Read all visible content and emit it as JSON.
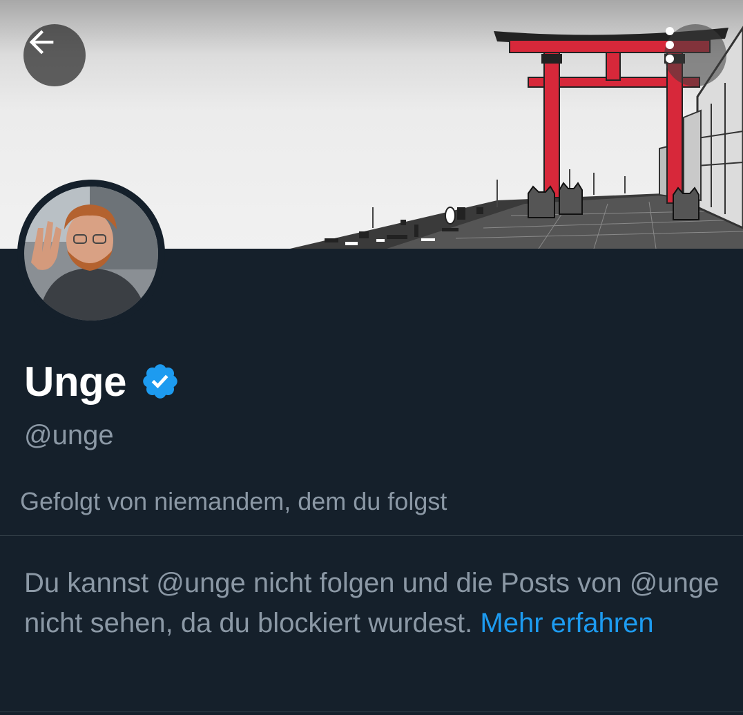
{
  "header": {
    "back_icon": "arrow-left-icon",
    "more_icon": "more-vertical-icon"
  },
  "banner": {
    "description_icon": "torii-gate-street-illustration",
    "accent_color": "#d7283a"
  },
  "profile": {
    "display_name": "Unge",
    "verified_icon": "verified-badge-icon",
    "verified_color": "#1d9bf0",
    "handle": "@unge",
    "followed_by": "Gefolgt von niemandem, dem du folgst"
  },
  "blocked_notice": {
    "text": "Du kannst @unge nicht folgen und die Posts von @unge nicht sehen, da du blockiert wurdest. ",
    "link_label": "Mehr erfahren",
    "link_color": "#1d9bf0"
  },
  "theme": {
    "background": "#15202b",
    "muted_text": "#8b98a5",
    "divider": "#38444d"
  }
}
